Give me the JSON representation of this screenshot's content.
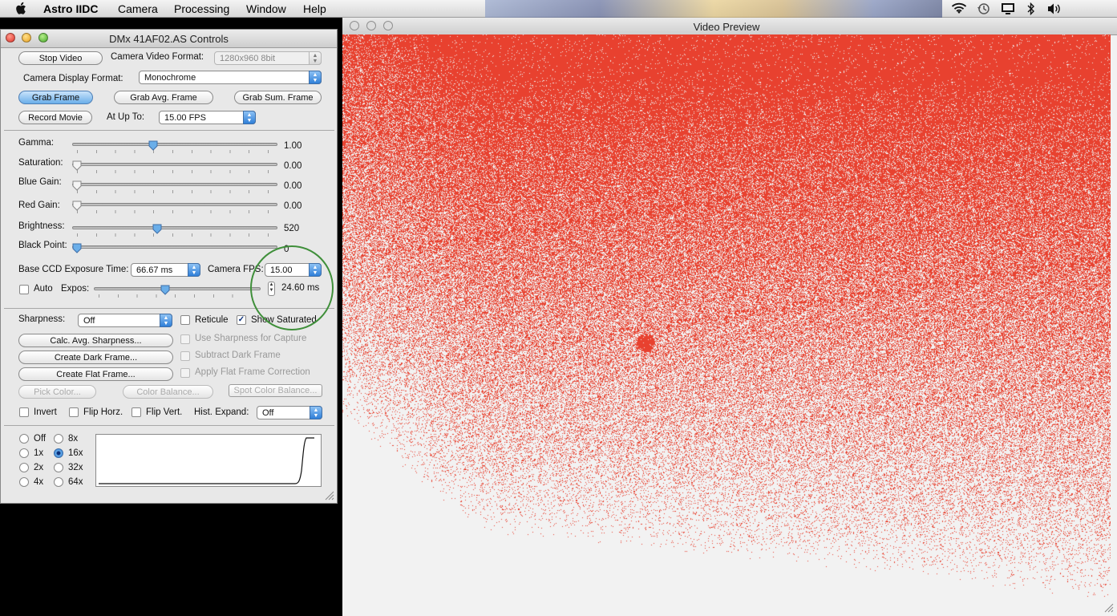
{
  "menubar": {
    "app_name": "Astro IIDC",
    "items": [
      "Camera",
      "Processing",
      "Window",
      "Help"
    ]
  },
  "controls_window": {
    "title": "DMx 41AF02.AS Controls",
    "stop_video_label": "Stop Video",
    "camera_video_format_label": "Camera Video Format:",
    "camera_video_format_value": "1280x960 8bit",
    "camera_display_format_label": "Camera Display Format:",
    "camera_display_format_value": "Monochrome",
    "grab_frame_label": "Grab Frame",
    "grab_avg_frame_label": "Grab Avg. Frame",
    "grab_sum_frame_label": "Grab Sum. Frame",
    "record_movie_label": "Record Movie",
    "at_up_to_label": "At Up To:",
    "at_up_to_value": "15.00 FPS",
    "sliders": [
      {
        "label": "Gamma:",
        "value": "1.00",
        "level": 0.37
      },
      {
        "label": "Saturation:",
        "value": "0.00",
        "level": 0.0
      },
      {
        "label": "Blue Gain:",
        "value": "0.00",
        "level": 0.0
      },
      {
        "label": "Red Gain:",
        "value": "0.00",
        "level": 0.0
      },
      {
        "label": "Brightness:",
        "value": "520",
        "level": 0.39
      },
      {
        "label": "Black Point:",
        "value": "0",
        "level": 0.0
      }
    ],
    "base_ccd_label": "Base CCD Exposure Time:",
    "base_ccd_value": "66.67 ms",
    "camera_fps_label": "Camera FPS:",
    "camera_fps_value": "15.00",
    "auto_label": "Auto",
    "expos_label": "Expos:",
    "expos_value": "24.60 ms",
    "expos_level": 0.4,
    "sharpness_label": "Sharpness:",
    "sharpness_value": "Off",
    "reticule_label": "Reticule",
    "show_saturated_label": "Show Saturated",
    "calc_avg_sharpness_label": "Calc. Avg. Sharpness...",
    "use_sharpness_label": "Use Sharpness for Capture",
    "create_dark_frame_label": "Create Dark Frame...",
    "subtract_dark_frame_label": "Subtract Dark Frame",
    "create_flat_frame_label": "Create Flat Frame...",
    "apply_flat_label": "Apply Flat Frame Correction",
    "pick_color_label": "Pick Color...",
    "color_balance_label": "Color Balance...",
    "spot_color_balance_label": "Spot Color Balance...",
    "invert_label": "Invert",
    "flip_horz_label": "Flip Horz.",
    "flip_vert_label": "Flip Vert.",
    "hist_expand_label": "Hist. Expand:",
    "hist_expand_value": "Off",
    "zoom_options": [
      "Off",
      "1x",
      "2x",
      "4x",
      "8x",
      "16x",
      "32x",
      "64x"
    ],
    "zoom_selected": "16x"
  },
  "video_window": {
    "title": "Video Preview"
  },
  "colors": {
    "noise": "#e8412f",
    "highlight_circle": "#3f8f3a",
    "accent": "#2f7fd8"
  }
}
